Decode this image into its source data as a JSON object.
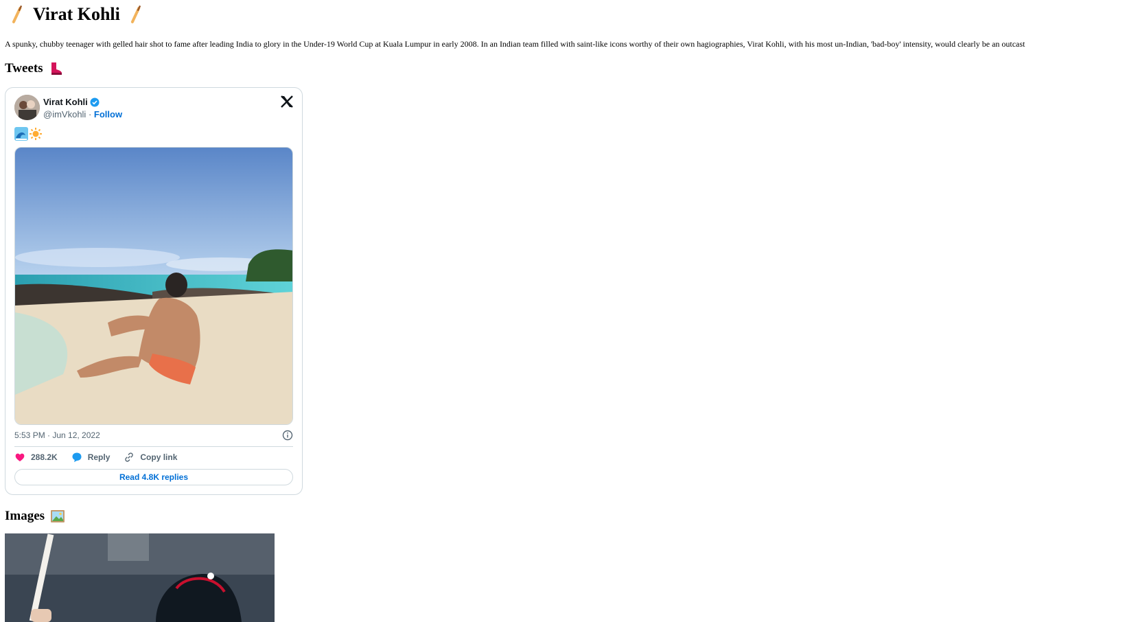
{
  "page": {
    "title": "Virat Kohli",
    "title_icon": "cricket-bat-icon",
    "intro": "A spunky, chubby teenager with gelled hair shot to fame after leading India to glory in the Under-19 World Cup at Kuala Lumpur in early 2008. In an Indian team filled with saint-like icons worthy of their own hagiographies, Virat Kohli, with his most un-Indian, 'bad-boy' intensity, would clearly be an outcast"
  },
  "sections": {
    "tweets": {
      "label": "Tweets",
      "icon": "boot-icon"
    },
    "images": {
      "label": "Images",
      "icon": "framed-picture-icon"
    }
  },
  "tweet": {
    "author_name": "Virat Kohli",
    "handle": "@imVkohli",
    "separator": "·",
    "follow_label": "Follow",
    "text_icons": [
      "wave-icon",
      "sun-icon"
    ],
    "timestamp": "5:53 PM · Jun 12, 2022",
    "likes": "288.2K",
    "reply_label": "Reply",
    "copy_link_label": "Copy link",
    "read_replies_label": "Read 4.8K replies",
    "colors": {
      "link": "#006fd6",
      "heart": "#f91880",
      "reply": "#1d9bf0",
      "verified": "#1d9bf0"
    }
  }
}
